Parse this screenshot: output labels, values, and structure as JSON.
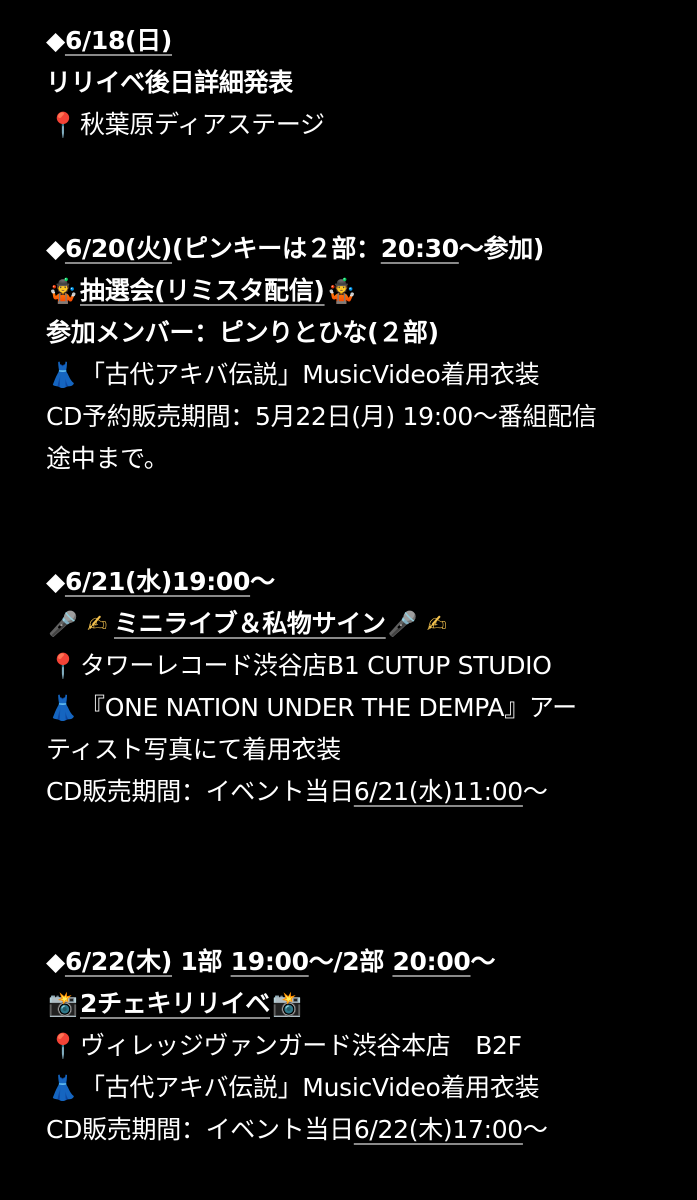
{
  "colors": {
    "background": "#000000",
    "text": "#ffffff",
    "underline": "#8a8a8a"
  },
  "events": [
    {
      "date_head": "◆",
      "date": "6/18(日)",
      "date_tail": "",
      "title": "リリイベ後日詳細発表",
      "venue_icon": "pin-icon",
      "venue": "秋葉原ディアステージ"
    },
    {
      "date_head": "◆",
      "date": "6/20(火)",
      "date_mid": "(ピンキーは２部：",
      "date_time": "20:30",
      "date_tail": "〜参加)",
      "title_icon": "juggler-icon",
      "title": "抽選会(リミスタ配信)",
      "members": "参加メンバー：ピンりとひな(２部)",
      "costume_icon": "dress-icon",
      "costume": "「古代アキバ伝説」MusicVideo着用衣装",
      "cd_line1": "CD予約販売期間：5月22日(月) 19:00〜番組配信",
      "cd_line2": "途中まで。"
    },
    {
      "date_head": "◆",
      "date": "6/21(水)19:00",
      "date_tail": "〜",
      "title": "ミニライブ＆私物サイン",
      "venue_icon": "pin-icon",
      "venue": "タワーレコード渋谷店B1 CUTUP STUDIO",
      "costume_icon": "dress-icon",
      "costume_line1": "『ONE NATION UNDER THE DEMPA』アー",
      "costume_line2": "ティスト写真にて着用衣装",
      "cd_prefix": "CD販売期間：イベント当日",
      "cd_date": "6/21(水)11:00",
      "cd_suffix": "〜"
    },
    {
      "date_head": "◆",
      "date": "6/22(木)",
      "part1_label": " 1部 ",
      "part1_time": "19:00",
      "sep": "〜/2部 ",
      "part2_time": "20:00",
      "date_tail": "〜",
      "title": "2チェキリリイベ",
      "venue_icon": "pin-icon",
      "venue": "ヴィレッジヴァンガード渋谷本店　B2F",
      "costume_icon": "dress-icon",
      "costume": "「古代アキバ伝説」MusicVideo着用衣装",
      "cd_prefix": "CD販売期間：イベント当日",
      "cd_date": "6/22(木)17:00",
      "cd_suffix": "〜"
    }
  ]
}
